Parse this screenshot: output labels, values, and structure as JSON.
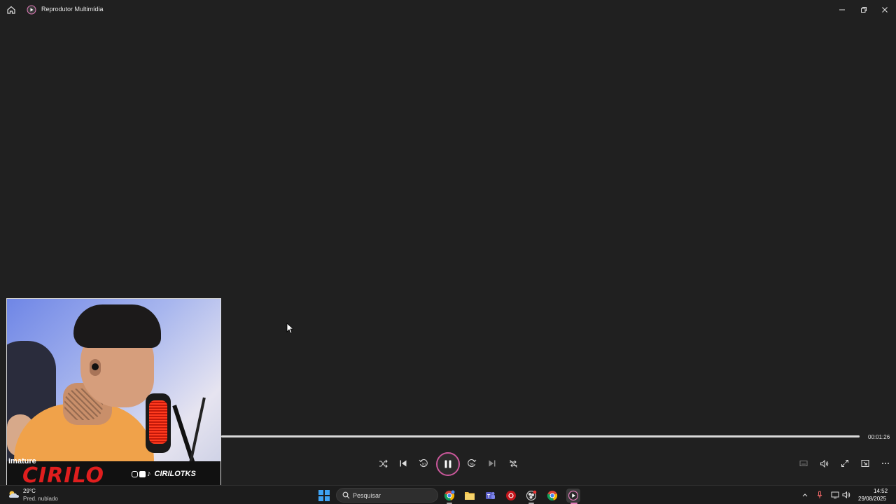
{
  "window": {
    "title": "Reprodutor Multimídia"
  },
  "webcam": {
    "overlay_text": "imature",
    "channel_name": "CIRILO",
    "social_handle": "CIRILOTKS"
  },
  "player": {
    "progress": 1.0,
    "elapsed_time": "00:01:26",
    "accent_color": "#c9579a"
  },
  "controls": {
    "shuffle": "shuffle-icon",
    "previous": "previous-icon",
    "rewind": "rewind-10-icon",
    "play_pause": "pause-icon",
    "forward": "forward-30-icon",
    "next": "next-icon",
    "repeat": "repeat-off-icon"
  },
  "taskbar": {
    "weather_temp": "29°C",
    "weather_desc": "Pred. nublado",
    "search_placeholder": "Pesquisar",
    "clock_time": "14:52",
    "clock_date": "29/08/2025"
  }
}
